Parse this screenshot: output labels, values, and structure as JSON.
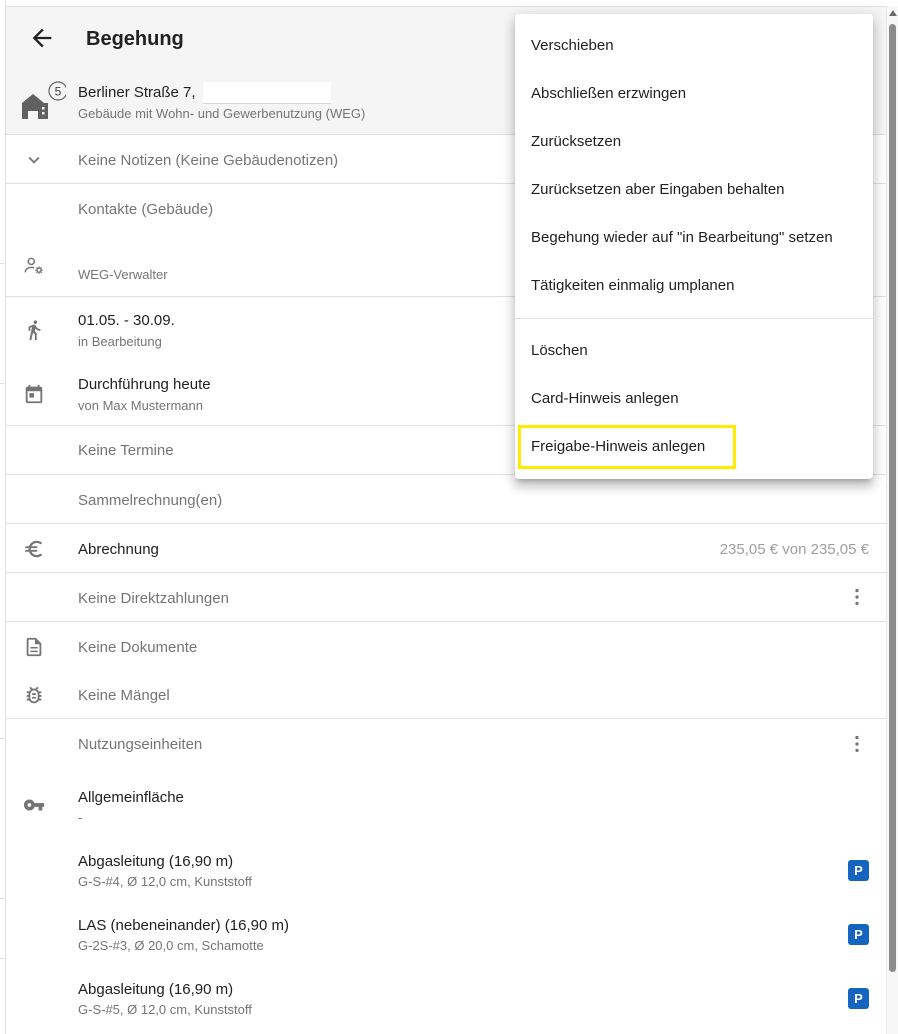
{
  "header": {
    "title": "Begehung",
    "building_count": "5",
    "address": "Berliner Straße 7,",
    "usage": "Gebäude mit Wohn- und Gewerbenutzung (WEG)"
  },
  "notes": {
    "label": "Keine Notizen (Keine Gebäudenotizen)"
  },
  "contacts": {
    "heading": "Kontakte (Gebäude)",
    "role": "WEG-Verwalter"
  },
  "period": {
    "dates": "01.05. - 30.09.",
    "status": "in Bearbeitung"
  },
  "execution": {
    "title": "Durchführung heute",
    "by": "von Max Mustermann"
  },
  "appointments": {
    "label": "Keine Termine"
  },
  "collective_invoice": {
    "label": "Sammelrechnung(en)"
  },
  "billing": {
    "label": "Abrechnung",
    "amount": "235,05 € von 235,05 €"
  },
  "direct_payments": {
    "label": "Keine Direktzahlungen"
  },
  "documents": {
    "label": "Keine Dokumente"
  },
  "defects": {
    "label": "Keine Mängel"
  },
  "usage_units": {
    "heading": "Nutzungseinheiten",
    "items": [
      {
        "title": "Allgemeinfläche",
        "detail": "-"
      },
      {
        "title": "Abgasleitung (16,90 m)",
        "detail": "G-S-#4, Ø 12,0 cm, Kunststoff",
        "badge": "P"
      },
      {
        "title": "LAS (nebeneinander) (16,90 m)",
        "detail": "G-2S-#3, Ø 20,0 cm, Schamotte",
        "badge": "P"
      },
      {
        "title": "Abgasleitung (16,90 m)",
        "detail": "G-S-#5, Ø 12,0 cm, Kunststoff",
        "badge": "P"
      }
    ]
  },
  "menu": {
    "items": [
      "Verschieben",
      "Abschließen erzwingen",
      "Zurücksetzen",
      "Zurücksetzen aber Eingaben behalten",
      "Begehung wieder auf \"in Bearbeitung\" setzen",
      "Tätigkeiten einmalig umplanen",
      "Löschen",
      "Card-Hinweis anlegen",
      "Freigabe-Hinweis anlegen"
    ],
    "highlighted_index": 8,
    "highlight_color": "#ffeb00"
  },
  "icons": {
    "back": "arrow-left-icon",
    "building": "home-city-icon",
    "notes": "chevron-down-icon",
    "contacts": "account-cog-icon",
    "period": "walk-icon",
    "execution": "calendar-icon",
    "billing": "euro-icon",
    "more": "dots-vertical-icon",
    "documents": "file-document-icon",
    "defects": "bug-icon",
    "unit": "key-icon"
  },
  "colors": {
    "badge": "#1565c0",
    "header_bg": "#f5f5f5",
    "divider": "#e0e0e0"
  }
}
